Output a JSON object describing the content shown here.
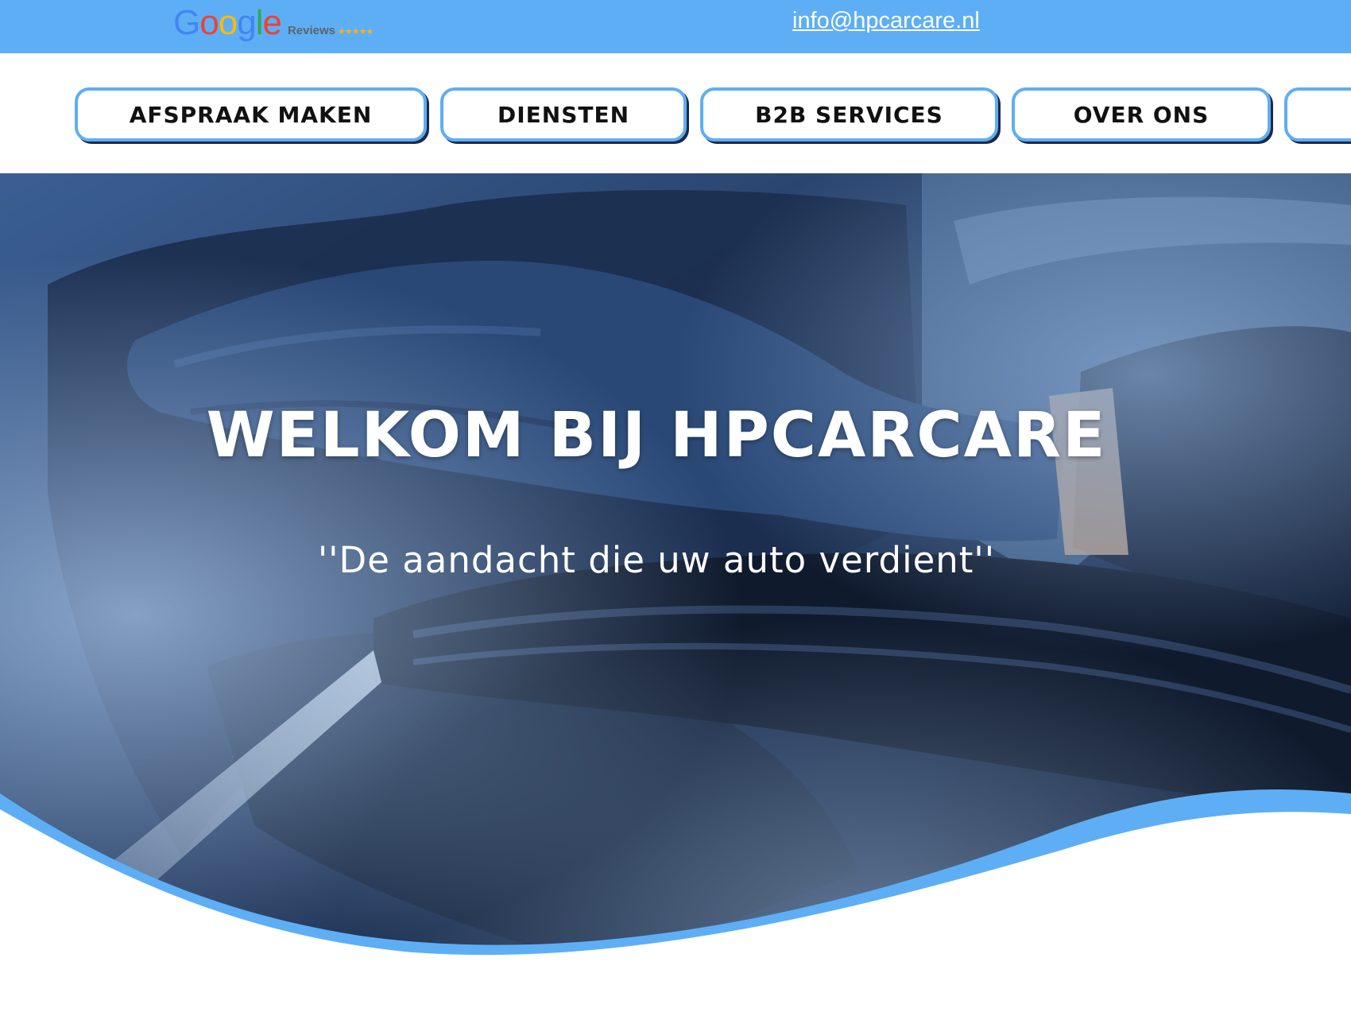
{
  "topbar": {
    "google_logo_text": "Google",
    "google_reviews_label": "Reviews",
    "google_stars": "★★★★★",
    "email": "info@hpcarcare.nl"
  },
  "nav": {
    "items": [
      {
        "label": "AFSPRAAK MAKEN"
      },
      {
        "label": "DIENSTEN"
      },
      {
        "label": "B2B SERVICES"
      },
      {
        "label": "OVER ONS"
      },
      {
        "label": ""
      }
    ]
  },
  "hero": {
    "title": "WELKOM BIJ HPCARCARE",
    "subtitle": "''De aandacht die uw auto verdient''"
  },
  "colors": {
    "accent": "#5eaef5",
    "hero_dark": "#1a2c4a",
    "white": "#ffffff"
  }
}
